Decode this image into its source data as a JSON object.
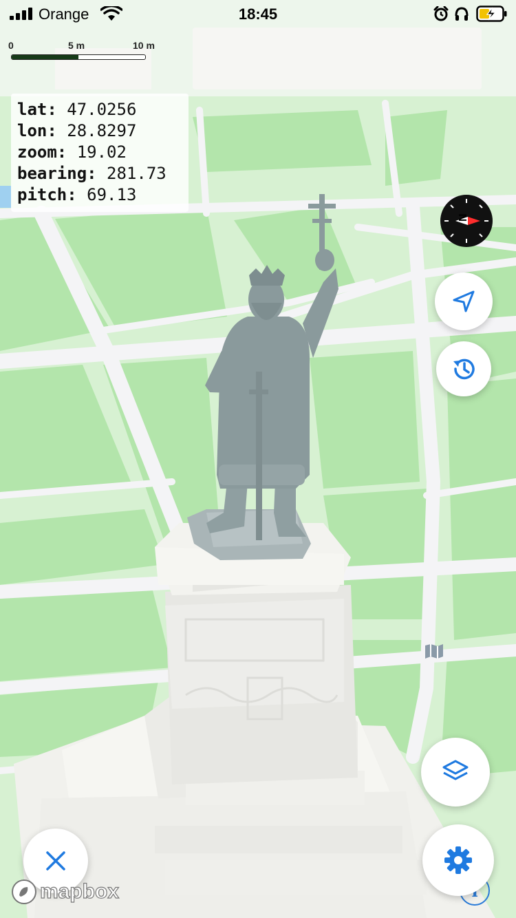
{
  "status_bar": {
    "carrier": "Orange",
    "time": "18:45",
    "icons": [
      "signal-icon",
      "wifi-icon",
      "alarm-icon",
      "headphones-icon",
      "battery-charging-icon"
    ]
  },
  "scale_bar": {
    "labels": [
      "0",
      "5 m",
      "10 m"
    ],
    "unit": "m"
  },
  "debug_panel": {
    "rows": [
      {
        "key": "lat:",
        "value": "47.0256"
      },
      {
        "key": "lon:",
        "value": "28.8297"
      },
      {
        "key": "zoom:",
        "value": "19.02"
      },
      {
        "key": "bearing:",
        "value": "281.73"
      },
      {
        "key": "pitch:",
        "value": "69.13"
      }
    ]
  },
  "controls": {
    "compass_letter": "N",
    "close_icon": "close-icon",
    "settings_icon": "gear-icon",
    "layers_icon": "layers-icon",
    "locate_icon": "navigation-arrow-icon",
    "history_icon": "history-icon"
  },
  "attribution": {
    "logo_text": "mapbox",
    "info_label": "i"
  },
  "colors": {
    "accent": "#1f7ae0",
    "park_green": "#b5e6ae",
    "road": "#ffffff",
    "statue": "#8e9ea0",
    "pedestal": "#f3f3ef"
  }
}
